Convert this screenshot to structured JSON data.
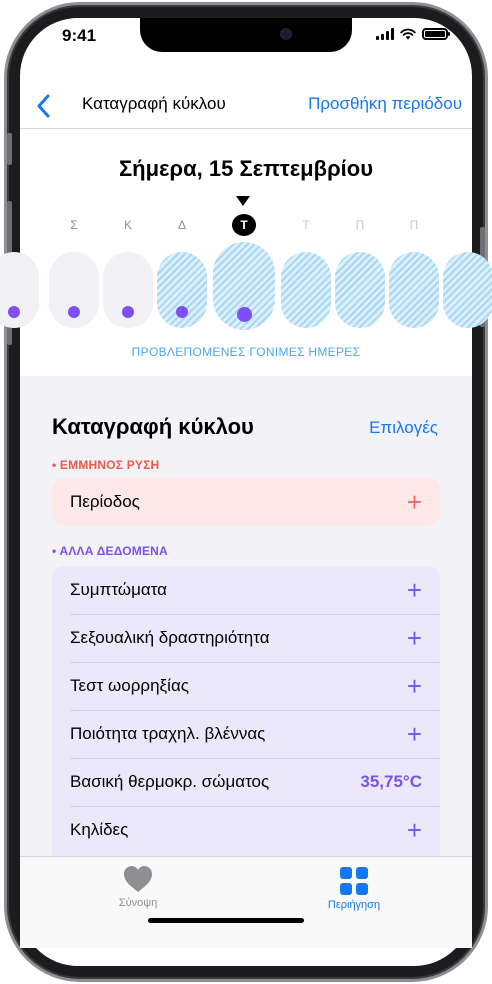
{
  "status_bar": {
    "time": "9:41"
  },
  "nav": {
    "title": "Καταγραφή κύκλου",
    "add_period": "Προσθήκη περιόδου"
  },
  "date_header": "Σήμερα, 15 Σεπτεμβρίου",
  "calendar": {
    "days": [
      {
        "letter": "",
        "fertile": false,
        "logged_dot": true,
        "today": false,
        "future": false
      },
      {
        "letter": "Σ",
        "fertile": false,
        "logged_dot": true,
        "today": false,
        "future": false
      },
      {
        "letter": "Κ",
        "fertile": false,
        "logged_dot": true,
        "today": false,
        "future": false
      },
      {
        "letter": "Δ",
        "fertile": true,
        "logged_dot": true,
        "today": false,
        "future": false
      },
      {
        "letter": "Τ",
        "fertile": true,
        "logged_dot": true,
        "today": true,
        "future": false
      },
      {
        "letter": "Τ",
        "fertile": true,
        "logged_dot": false,
        "today": false,
        "future": true
      },
      {
        "letter": "Π",
        "fertile": true,
        "logged_dot": false,
        "today": false,
        "future": true
      },
      {
        "letter": "Π",
        "fertile": true,
        "logged_dot": false,
        "today": false,
        "future": true
      },
      {
        "letter": "",
        "fertile": true,
        "logged_dot": false,
        "today": false,
        "future": true
      }
    ],
    "fertile_label": "ΠΡΟΒΛΕΠΟΜΕΝΕΣ ΓΟΝΙΜΕΣ ΗΜΕΡΕΣ"
  },
  "log": {
    "title": "Καταγραφή κύκλου",
    "options_label": "Επιλογές",
    "menstrual_label": "• ΕΜΜΗΝΟΣ ΡΥΣΗ",
    "period_row": "Περίοδος",
    "other_label": "• ΑΛΛΑ ΔΕΔΟΜΕΝΑ",
    "other_rows": [
      {
        "label": "Συμπτώματα",
        "value": null
      },
      {
        "label": "Σεξουαλική δραστηριότητα",
        "value": null
      },
      {
        "label": "Τεστ ωορρηξίας",
        "value": null
      },
      {
        "label": "Ποιότητα τραχηλ. βλέννας",
        "value": null
      },
      {
        "label": "Βασική θερμοκρ. σώματος",
        "value": "35,75°C"
      },
      {
        "label": "Κηλίδες",
        "value": null
      }
    ],
    "plus_symbol": "+"
  },
  "tab_bar": {
    "summary": {
      "label": "Σύνοψη",
      "icon": "heart-icon"
    },
    "browse": {
      "label": "Περιήγηση",
      "icon": "grid-icon"
    }
  },
  "colors": {
    "accent_blue": "#1677f0",
    "menstrual_red": "#ee5a4a",
    "other_purple": "#7b52e8",
    "fertile_blue": "#a8d6f5",
    "dot_purple": "#7d4ff5"
  }
}
